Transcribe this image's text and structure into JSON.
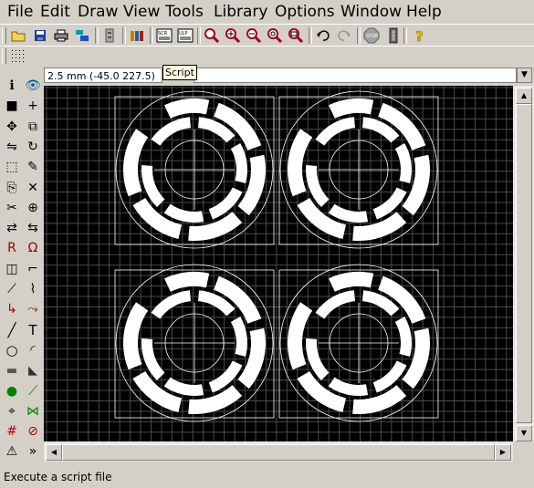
{
  "menu": [
    "File",
    "Edit",
    "Draw",
    "View",
    "Tools",
    "Library",
    "Options",
    "Window",
    "Help"
  ],
  "coord_readout": "2.5 mm (-45.0 227.5)",
  "tooltip": "Script",
  "status": "Execute a script file",
  "toolbar_icons": [
    "open-icon",
    "save-icon",
    "print-icon",
    "cam-icon",
    "drc-icon",
    "library-icon",
    "script-icon",
    "ulp-icon",
    "zoom-fit-icon",
    "zoom-in-icon",
    "zoom-out-icon",
    "zoom-redraw-icon",
    "zoom-select-icon",
    "undo-icon",
    "redo-icon",
    "stop-icon",
    "go-icon",
    "help-icon"
  ],
  "left_tools": [
    "info-icon",
    "show-icon",
    "display-icon",
    "mark-icon",
    "move-icon",
    "copy-icon",
    "mirror-icon",
    "rotate-icon",
    "group-icon",
    "change-icon",
    "paste-icon",
    "delete-icon",
    "cut-icon",
    "add-icon",
    "replace-icon",
    "pinswap-icon",
    "name-icon",
    "value-icon",
    "smash-icon",
    "miter-icon",
    "split-icon",
    "optimize-icon",
    "route-icon",
    "ripup-icon",
    "wire-icon",
    "text-icon",
    "circle-icon",
    "arc-icon",
    "rect-icon",
    "polygon-icon",
    "via-icon",
    "signal-icon",
    "hole-icon",
    "ratsnest-icon",
    "auto-icon",
    "erc-icon",
    "errors-icon",
    "more-icon"
  ],
  "colors": {
    "canvas": "#000000",
    "grid": "#4a4a4a",
    "pads": "#ffffff",
    "chrome": "#d4d0c8"
  }
}
